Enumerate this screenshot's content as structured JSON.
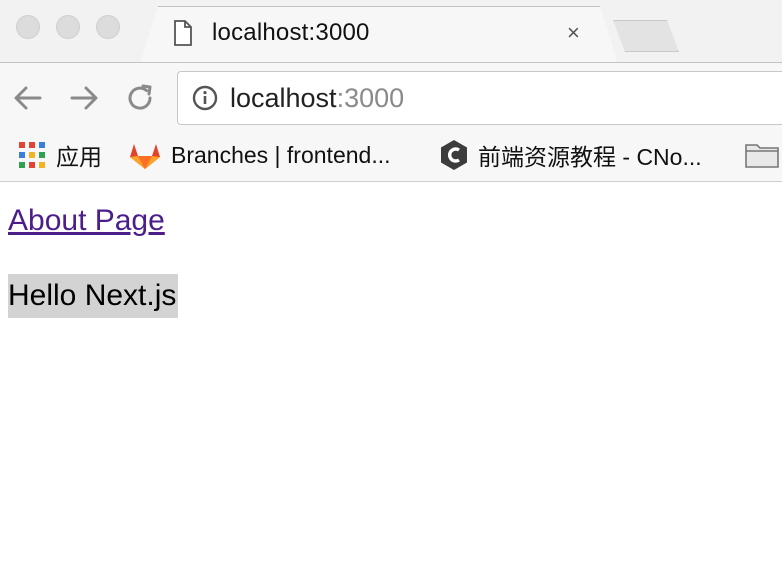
{
  "browser": {
    "tab": {
      "title": "localhost:3000",
      "close_label": "×",
      "icon": "document-icon"
    },
    "toolbar": {
      "back_icon": "arrow-left-icon",
      "forward_icon": "arrow-right-icon",
      "reload_icon": "reload-icon",
      "address": {
        "host": "localhost",
        "port": ":3000",
        "security_icon": "info-icon"
      }
    },
    "bookmarks": [
      {
        "label": "应用",
        "icon": "apps-grid-icon"
      },
      {
        "label": "Branches | frontend...",
        "icon": "gitlab-icon"
      },
      {
        "label": "前端资源教程 - CNo...",
        "icon": "cnode-icon"
      },
      {
        "label": "",
        "icon": "folder-icon"
      }
    ]
  },
  "page": {
    "link_text": "About Page",
    "heading": "Hello Next.js"
  },
  "colors": {
    "link_visited": "#4b1e8c",
    "highlight": "#d3d3d3"
  }
}
